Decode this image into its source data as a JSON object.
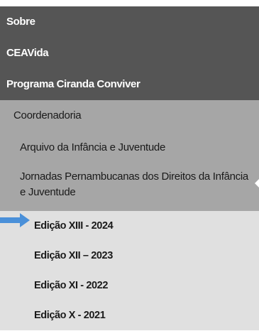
{
  "menu": {
    "top_items": [
      {
        "label": "Sobre"
      },
      {
        "label": "CEAVida"
      },
      {
        "label": "Programa Ciranda Conviver"
      }
    ],
    "sub_items": {
      "coordenadoria": "Coordenadoria",
      "arquivo": "Arquivo da Infância e Juventude",
      "jornadas": "Jornadas Pernambucanas dos Direitos da Infância e Juventude"
    },
    "editions": [
      {
        "label": "Edição XIII - 2024"
      },
      {
        "label": "Edição XII – 2023"
      },
      {
        "label": "Edição XI - 2022"
      },
      {
        "label": "Edição X - 2021"
      }
    ]
  },
  "colors": {
    "level1_bg": "#555555",
    "level2_bg": "#a6a6a6",
    "level3_bg": "#e0e0e0",
    "pointer_arrow": "#4a90d9"
  },
  "icons": {
    "pointer": "right-arrow-icon",
    "expanded_caret": "caret-left-icon"
  }
}
